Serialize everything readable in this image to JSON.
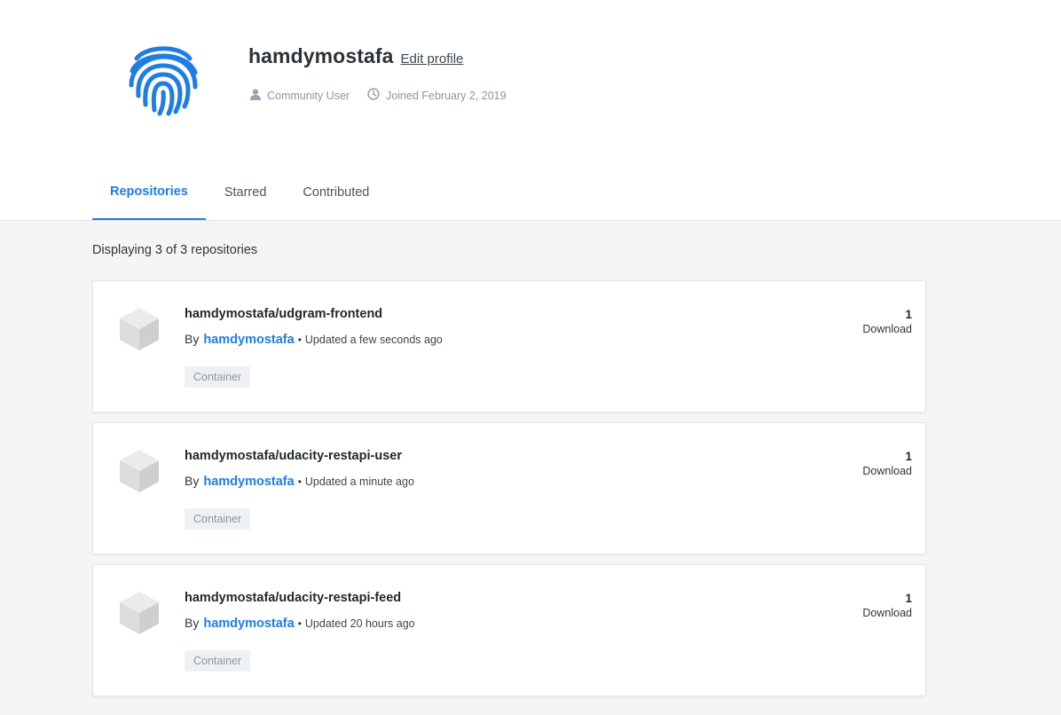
{
  "profile": {
    "username": "hamdymostafa",
    "edit_label": "Edit profile",
    "role": "Community User",
    "joined": "Joined February 2, 2019",
    "avatar_icon": "fingerprint-icon",
    "accent_color": "#1f7de4"
  },
  "tabs": [
    {
      "label": "Repositories",
      "active": true
    },
    {
      "label": "Starred",
      "active": false
    },
    {
      "label": "Contributed",
      "active": false
    }
  ],
  "list": {
    "count_text": "Displaying 3 of 3 repositories"
  },
  "repos": [
    {
      "name": "hamdymostafa/udgram-frontend",
      "by_label": "By",
      "author": "hamdymostafa",
      "updated": "Updated a few seconds ago",
      "tag": "Container",
      "downloads": "1",
      "downloads_label": "Download"
    },
    {
      "name": "hamdymostafa/udacity-restapi-user",
      "by_label": "By",
      "author": "hamdymostafa",
      "updated": "Updated a minute ago",
      "tag": "Container",
      "downloads": "1",
      "downloads_label": "Download"
    },
    {
      "name": "hamdymostafa/udacity-restapi-feed",
      "by_label": "By",
      "author": "hamdymostafa",
      "updated": "Updated 20 hours ago",
      "tag": "Container",
      "downloads": "1",
      "downloads_label": "Download"
    }
  ]
}
